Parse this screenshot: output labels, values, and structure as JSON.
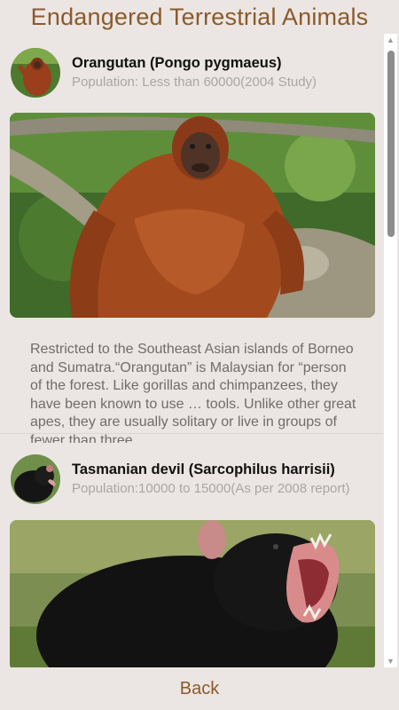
{
  "header": {
    "title": "Endangered Terrestrial Animals"
  },
  "animals": [
    {
      "name": "Orangutan (Pongo pygmaeus)",
      "population": "Population: Less than 60000(2004 Study)",
      "description": "Restricted to the Southeast Asian islands of Borneo and Sumatra.“Orangutan” is Malaysian for “person of the forest. Like gorillas and chimpanzees, they have been known to use … tools. Unlike other great apes, they are usually solitary or live in groups of fewer than three,"
    },
    {
      "name": "Tasmanian devil (Sarcophilus harrisii)",
      "population": "Population:10000 to 15000(As per 2008 report)"
    }
  ],
  "footer": {
    "back_label": "Back"
  },
  "scrollbar": {
    "up_icon": "▲",
    "down_icon": "▼"
  },
  "colors": {
    "accent": "#8b5a2b",
    "background": "#ebe6e3"
  }
}
